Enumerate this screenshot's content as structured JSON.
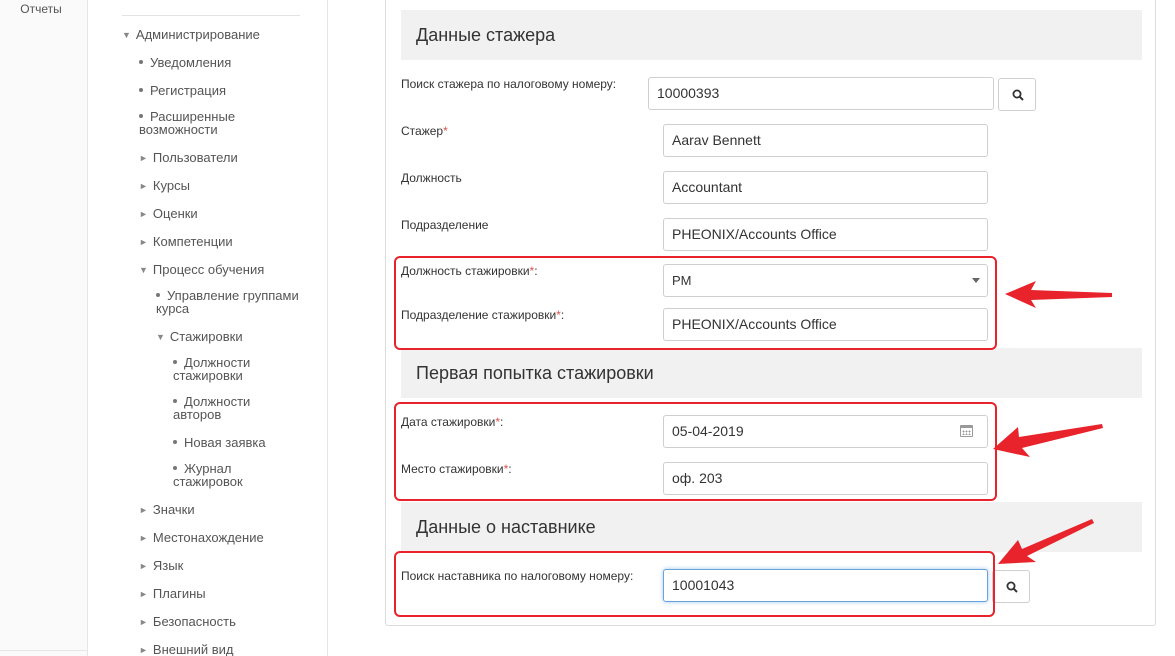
{
  "left_rail": {
    "reports_label": "Отчеты"
  },
  "nav": {
    "admin": "Администрирование",
    "notifications": "Уведомления",
    "registration": "Регистрация",
    "advanced_line1": "Расширенные",
    "advanced_line2": "возможности",
    "users": "Пользователи",
    "courses": "Курсы",
    "grades": "Оценки",
    "competencies": "Компетенции",
    "learning_process": "Процесс обучения",
    "group_mgmt_line1": "Управление группами",
    "group_mgmt_line2": "курса",
    "internships": "Стажировки",
    "positions_line1": "Должности",
    "positions_line2": "стажировки",
    "author_positions_line1": "Должности",
    "author_positions_line2": "авторов",
    "new_request": "Новая заявка",
    "journal_line1": "Журнал",
    "journal_line2": "стажировок",
    "badges": "Значки",
    "location": "Местонахождение",
    "language": "Язык",
    "plugins": "Плагины",
    "security": "Безопасность",
    "appearance": "Внешний вид"
  },
  "sections": {
    "trainee": "Данные стажера",
    "first_attempt": "Первая попытка стажировки",
    "mentor": "Данные о наставнике"
  },
  "form": {
    "search_trainee_label": "Поиск стажера по налоговому номеру:",
    "search_trainee_value": "10000393",
    "trainee_label": "Стажер",
    "trainee_value": "Aarav Bennett",
    "position_label": "Должность",
    "position_value": "Accountant",
    "department_label": "Подразделение",
    "department_value": "PHEONIX/Accounts Office",
    "intern_position_label": "Должность стажировки",
    "intern_position_value": "PM",
    "intern_department_label": "Подразделение стажировки",
    "intern_department_value": "PHEONIX/Accounts Office",
    "date_label": "Дата стажировки",
    "date_value": "05-04-2019",
    "place_label": "Место стажировки",
    "place_value": "оф. 203",
    "search_mentor_label": "Поиск наставника по налоговому номеру:",
    "search_mentor_value": "10001043",
    "required_mark": "*",
    "colon": ":"
  },
  "colors": {
    "annotation": "#e8232b",
    "required": "#d9534f",
    "section_bg": "#f1f1f1"
  },
  "icons": {
    "search": "search-icon",
    "calendar": "calendar-icon",
    "caret": "caret-down-icon"
  }
}
